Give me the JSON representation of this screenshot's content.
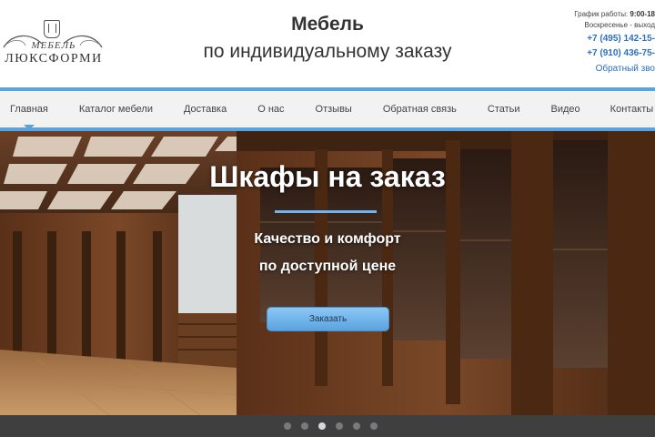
{
  "logo": {
    "top_text": "МЕБЕЛЬ",
    "main_text": "ЛЮКСФОРМИ"
  },
  "header": {
    "title_line1": "Мебель",
    "title_line2": "по индивидуальному заказу"
  },
  "contact": {
    "schedule_label": "График работы:",
    "schedule_hours": "9:00-18",
    "sunday": "Воскресенье - выход",
    "phone1": "+7 (495) 142-15-",
    "phone2": "+7 (910) 436-75-",
    "callback": "Обратный зво"
  },
  "nav": {
    "items": [
      {
        "label": "Главная"
      },
      {
        "label": "Каталог мебели"
      },
      {
        "label": "Доставка"
      },
      {
        "label": "О нас"
      },
      {
        "label": "Отзывы"
      },
      {
        "label": "Обратная связь"
      },
      {
        "label": "Статьи"
      },
      {
        "label": "Видео"
      },
      {
        "label": "Контакты"
      }
    ]
  },
  "hero": {
    "heading": "Шкафы на заказ",
    "sub_line1": "Качество и комфорт",
    "sub_line2": "по доступной цене",
    "button": "Заказать"
  },
  "slider": {
    "slides": 6,
    "active": 3
  },
  "colors": {
    "accent": "#5aa3e0",
    "link": "#2b6fc0"
  }
}
